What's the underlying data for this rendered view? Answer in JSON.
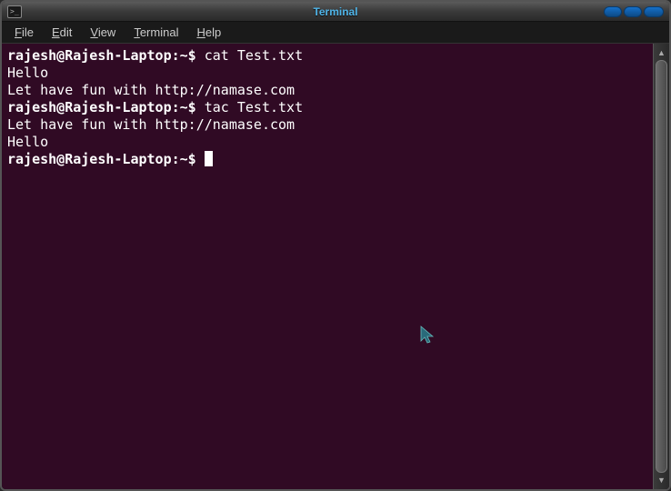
{
  "titlebar": {
    "title": "Terminal"
  },
  "menubar": {
    "items": [
      {
        "label": "File",
        "accel": "F"
      },
      {
        "label": "Edit",
        "accel": "E"
      },
      {
        "label": "View",
        "accel": "V"
      },
      {
        "label": "Terminal",
        "accel": "T"
      },
      {
        "label": "Help",
        "accel": "H"
      }
    ]
  },
  "terminal": {
    "lines": [
      {
        "prompt": "rajesh@Rajesh-Laptop:~$ ",
        "command": "cat Test.txt"
      },
      {
        "text": "Hello"
      },
      {
        "text": "Let have fun with http://namase.com"
      },
      {
        "prompt": "rajesh@Rajesh-Laptop:~$ ",
        "command": "tac Test.txt"
      },
      {
        "text": "Let have fun with http://namase.com"
      },
      {
        "text": "Hello"
      },
      {
        "prompt": "rajesh@Rajesh-Laptop:~$ ",
        "command": "",
        "cursor": true
      }
    ]
  }
}
